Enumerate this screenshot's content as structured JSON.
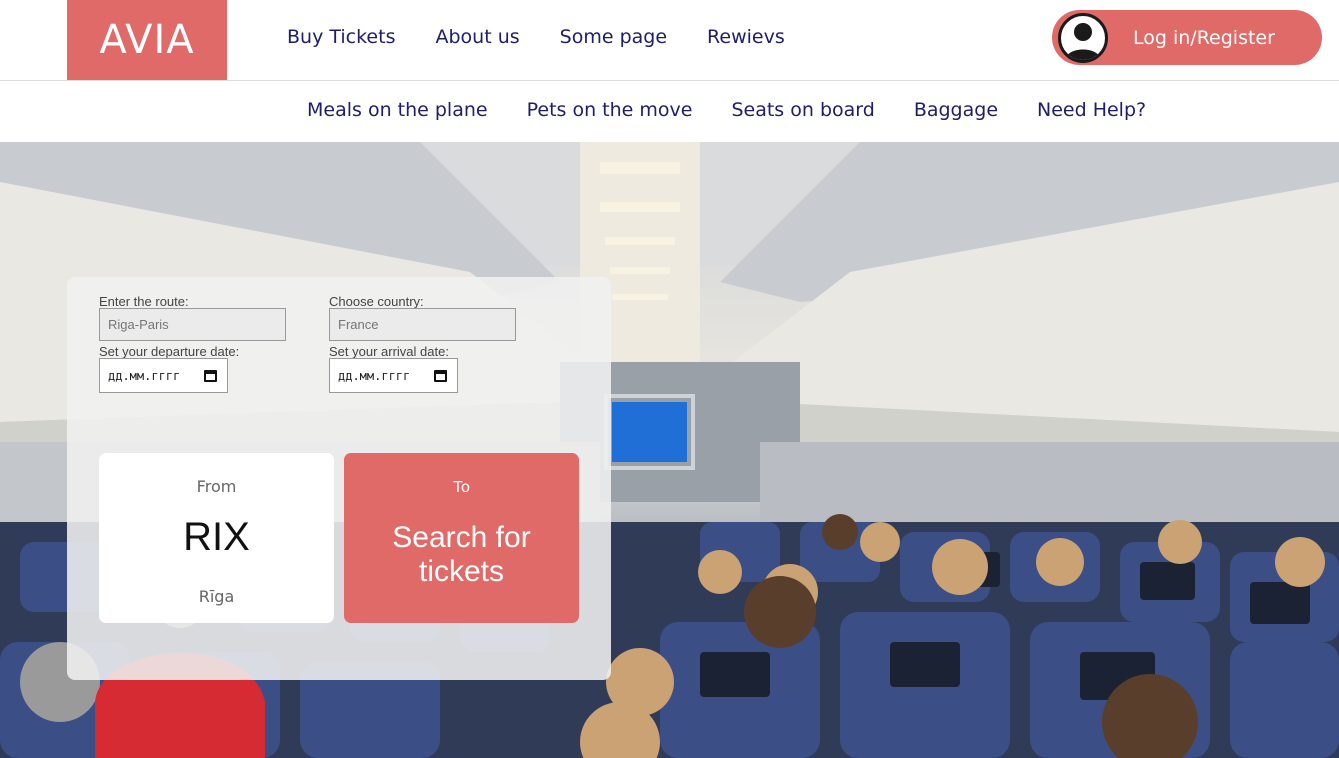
{
  "header": {
    "logo": "AVIA",
    "nav": [
      {
        "label": "Buy Tickets"
      },
      {
        "label": "About us"
      },
      {
        "label": "Some page"
      },
      {
        "label": "Rewievs"
      }
    ],
    "login_label": "Log in/Register"
  },
  "subnav": [
    {
      "label": "Meals on the plane"
    },
    {
      "label": "Pets on the move"
    },
    {
      "label": "Seats on board"
    },
    {
      "label": "Baggage"
    },
    {
      "label": "Need Help?"
    }
  ],
  "search": {
    "route_label": "Enter the route:",
    "route_placeholder": "Riga-Paris",
    "country_label": "Choose country:",
    "country_placeholder": "France",
    "departure_label": "Set your departure date:",
    "departure_value": "дд.мм.гггг",
    "arrival_label": "Set your arrival date:",
    "arrival_value": "дд.мм.гггг",
    "from": {
      "label": "From",
      "code": "RIX",
      "city": "Rīga"
    },
    "to": {
      "label": "To",
      "button": "Search for tickets"
    }
  },
  "colors": {
    "accent": "#e06a67",
    "nav_text": "#1d1d6b"
  },
  "icons": {
    "user": "user-avatar-icon",
    "calendar": "calendar-icon"
  }
}
